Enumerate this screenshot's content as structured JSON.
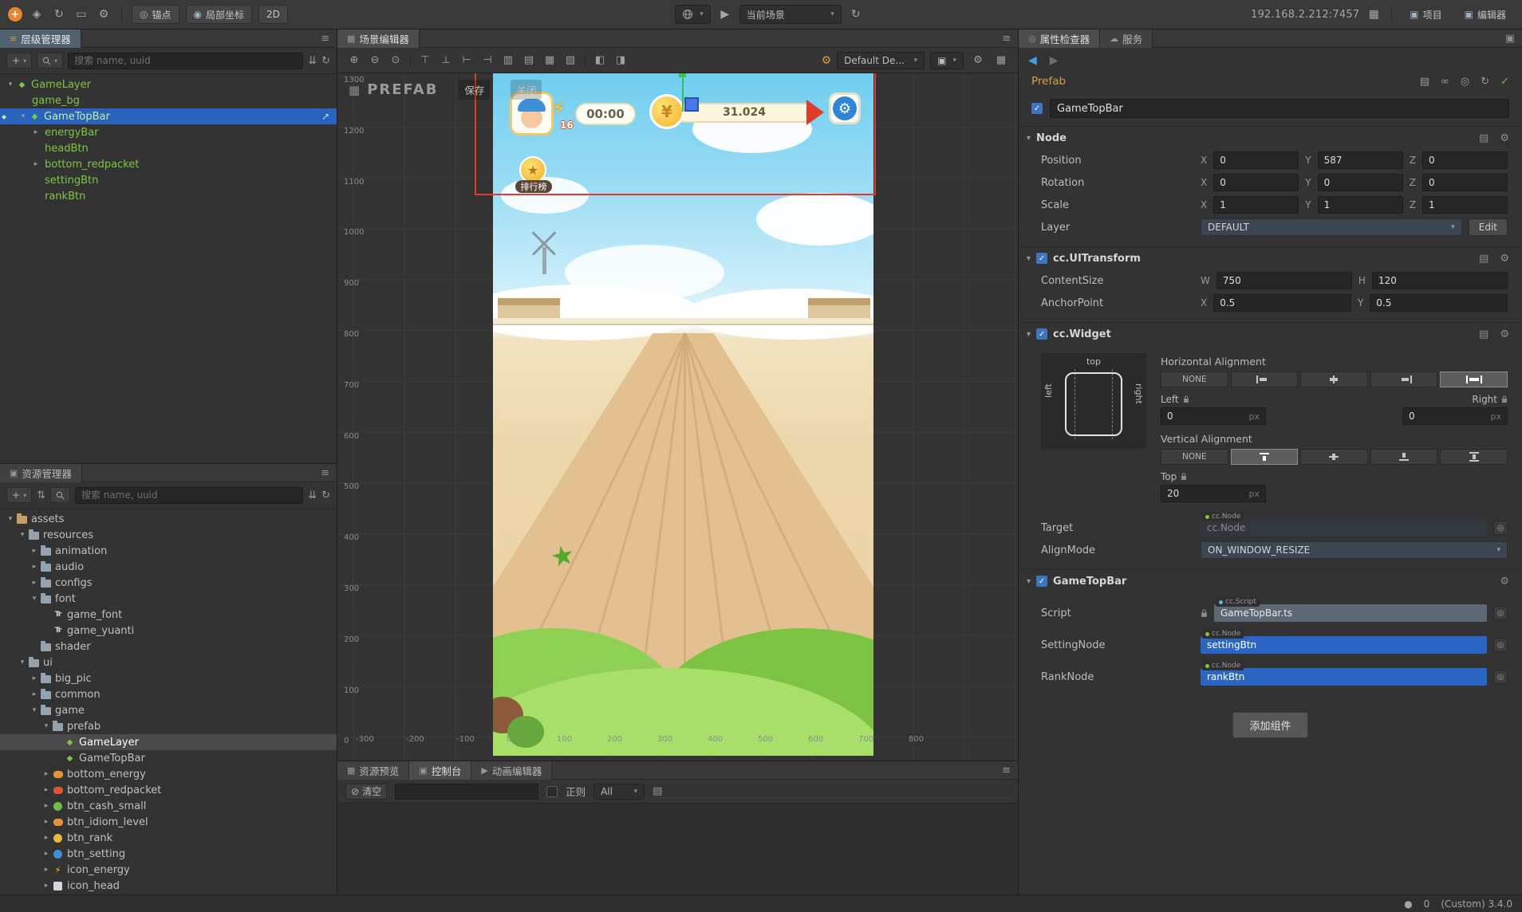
{
  "icons": {
    "hamburger": "≡",
    "list": "≡",
    "caret_down": "▾",
    "caret_right": "▸",
    "plus": "+",
    "refresh": "↻",
    "gear": "⚙",
    "play": "▶",
    "back": "◀",
    "forward": "▶",
    "sort": "⇅",
    "collapse_all": "⇊",
    "bolt": "⚡",
    "star": "★",
    "yen": "¥",
    "check": "✓",
    "open_external": "↗",
    "clear": "⊘",
    "doc": "▤",
    "grid": "▦",
    "panel": "▣",
    "target": "◎",
    "anchor_mode": "◎",
    "local_coords": "◉",
    "link": "∞",
    "move_tool": "◈",
    "rotate_tool": "↻",
    "scale_tool": "◱",
    "rect_tool": "▭",
    "cloud": "☁",
    "inspector": "◎",
    "dot": "●",
    "prefab": "◆"
  },
  "topbar": {
    "anchor": "锚点",
    "coords": "局部坐标",
    "mode2d": "2D",
    "scene_select": "当前场景",
    "ip": "192.168.2.212:7457",
    "project": "项目",
    "editor": "编辑器"
  },
  "hierarchy": {
    "title": "层级管理器",
    "search_placeholder": "搜索 name, uuid",
    "items": [
      {
        "label": "GameLayer",
        "level": 0,
        "arrow": "down",
        "icon": "prefab"
      },
      {
        "label": "game_bg",
        "level": 1,
        "arrow": "none",
        "icon": "none"
      },
      {
        "label": "GameTopBar",
        "level": 1,
        "arrow": "down",
        "icon": "prefab",
        "selected": true,
        "trailing": true
      },
      {
        "label": "energyBar",
        "level": 2,
        "arrow": "right",
        "icon": "none"
      },
      {
        "label": "headBtn",
        "level": 2,
        "arrow": "none",
        "icon": "none"
      },
      {
        "label": "bottom_redpacket",
        "level": 2,
        "arrow": "right",
        "icon": "none"
      },
      {
        "label": "settingBtn",
        "level": 2,
        "arrow": "none",
        "icon": "none"
      },
      {
        "label": "rankBtn",
        "level": 2,
        "arrow": "none",
        "icon": "none"
      }
    ]
  },
  "assets": {
    "title": "资源管理器",
    "search_placeholder": "搜索 name, uuid",
    "items": [
      {
        "label": "assets",
        "level": 0,
        "arrow": "down",
        "icon": "folder-root"
      },
      {
        "label": "resources",
        "level": 1,
        "arrow": "down",
        "icon": "folder"
      },
      {
        "label": "animation",
        "level": 2,
        "arrow": "right",
        "icon": "folder"
      },
      {
        "label": "audio",
        "level": 2,
        "arrow": "right",
        "icon": "folder"
      },
      {
        "label": "configs",
        "level": 2,
        "arrow": "right",
        "icon": "folder"
      },
      {
        "label": "font",
        "level": 2,
        "arrow": "down",
        "icon": "folder"
      },
      {
        "label": "game_font",
        "level": 3,
        "arrow": "none",
        "icon": "font-file"
      },
      {
        "label": "game_yuanti",
        "level": 3,
        "arrow": "none",
        "icon": "font-file"
      },
      {
        "label": "shader",
        "level": 2,
        "arrow": "none",
        "icon": "folder"
      },
      {
        "label": "ui",
        "level": 1,
        "arrow": "down",
        "icon": "folder"
      },
      {
        "label": "big_pic",
        "level": 2,
        "arrow": "right",
        "icon": "folder"
      },
      {
        "label": "common",
        "level": 2,
        "arrow": "right",
        "icon": "folder"
      },
      {
        "label": "game",
        "level": 2,
        "arrow": "down",
        "icon": "folder"
      },
      {
        "label": "prefab",
        "level": 3,
        "arrow": "down",
        "icon": "folder"
      },
      {
        "label": "GameLayer",
        "level": 4,
        "arrow": "none",
        "icon": "prefab",
        "selected": true
      },
      {
        "label": "GameTopBar",
        "level": 4,
        "arrow": "none",
        "icon": "prefab"
      },
      {
        "label": "bottom_energy",
        "level": 3,
        "arrow": "right",
        "icon": "sprite-orange"
      },
      {
        "label": "bottom_redpacket",
        "level": 3,
        "arrow": "right",
        "icon": "sprite-red"
      },
      {
        "label": "btn_cash_small",
        "level": 3,
        "arrow": "right",
        "icon": "sprite-green"
      },
      {
        "label": "btn_idiom_level",
        "level": 3,
        "arrow": "right",
        "icon": "sprite-orange"
      },
      {
        "label": "btn_rank",
        "level": 3,
        "arrow": "right",
        "icon": "sprite-gold"
      },
      {
        "label": "btn_setting",
        "level": 3,
        "arrow": "right",
        "icon": "sprite-blue"
      },
      {
        "label": "icon_energy",
        "level": 3,
        "arrow": "right",
        "icon": "sprite-bolt"
      },
      {
        "label": "icon_head",
        "level": 3,
        "arrow": "right",
        "icon": "sprite-image"
      }
    ]
  },
  "scene": {
    "tab": "场景编辑器",
    "prefab_label": "PREFAB",
    "save": "保存",
    "close": "关闭",
    "camera_select": "Default De...",
    "toolbar_icons": [
      {
        "name": "zoom-in-icon",
        "glyph": "⊕"
      },
      {
        "name": "zoom-out-icon",
        "glyph": "⊖"
      },
      {
        "name": "zoom-reset-icon",
        "glyph": "⊙"
      },
      {
        "name": "sep"
      },
      {
        "name": "align-top-icon",
        "glyph": "⊤"
      },
      {
        "name": "align-bottom-icon",
        "glyph": "⊥"
      },
      {
        "name": "align-left-icon",
        "glyph": "⊢"
      },
      {
        "name": "align-right-icon",
        "glyph": "⊣"
      },
      {
        "name": "align-center-h-icon",
        "glyph": "▥"
      },
      {
        "name": "align-center-v-icon",
        "glyph": "▤"
      },
      {
        "name": "distribute-h-icon",
        "glyph": "▦"
      },
      {
        "name": "distribute-v-icon",
        "glyph": "▧"
      },
      {
        "name": "sep"
      },
      {
        "name": "stretch-h-icon",
        "glyph": "◧"
      },
      {
        "name": "stretch-v-icon",
        "glyph": "◨"
      }
    ],
    "vruler": [
      "1300",
      "1200",
      "1100",
      "1000",
      "900",
      "800",
      "700",
      "600",
      "500",
      "400",
      "300",
      "200",
      "100",
      "0"
    ],
    "hruler": [
      "-300",
      "-200",
      "-100",
      "0",
      "100",
      "200",
      "300",
      "400",
      "500",
      "600",
      "700",
      "800"
    ],
    "game": {
      "timer": "00:00",
      "energy": "16",
      "coins": "31.024",
      "rank": "排行榜"
    }
  },
  "console": {
    "tabs": [
      {
        "label": "资源预览",
        "name": "asset-preview",
        "icon": "▦"
      },
      {
        "label": "控制台",
        "name": "console",
        "icon": "▣",
        "active": true
      },
      {
        "label": "动画编辑器",
        "name": "animation-editor",
        "icon": "▶"
      }
    ],
    "clear": "清空",
    "regex": "正则",
    "filter": "All"
  },
  "inspector": {
    "tab_inspector": "属性检查器",
    "tab_service": "服务",
    "prefab_badge": "Prefab",
    "node_name": "GameTopBar",
    "axes": {
      "x": "X",
      "y": "Y",
      "z": "Z"
    },
    "node": {
      "title": "Node",
      "position_label": "Position",
      "position": {
        "x": "0",
        "y": "587",
        "z": "0"
      },
      "rotation_label": "Rotation",
      "rotation": {
        "x": "0",
        "y": "0",
        "z": "0"
      },
      "scale_label": "Scale",
      "scale": {
        "x": "1",
        "y": "1",
        "z": "1"
      },
      "layer_label": "Layer",
      "layer_value": "DEFAULT",
      "edit": "Edit"
    },
    "uitransform": {
      "title": "cc.UITransform",
      "contentsize_label": "ContentSize",
      "w_label": "W",
      "w": "750",
      "h_label": "H",
      "h": "120",
      "anchorpoint_label": "AnchorPoint",
      "ax": "0.5",
      "ay": "0.5"
    },
    "widget": {
      "title": "cc.Widget",
      "h_align_label": "Horizontal Alignment",
      "v_align_label": "Vertical Alignment",
      "none": "NONE",
      "left_label": "Left",
      "right_label": "Right",
      "top_label": "Top",
      "left_value": "0",
      "right_value": "0",
      "top_value": "20",
      "px": "px",
      "diagram": {
        "top": "top",
        "left": "left",
        "right": "right"
      },
      "target_label": "Target",
      "target_type": "cc.Node",
      "target_value": "cc.Node",
      "alignmode_label": "AlignMode",
      "alignmode_value": "ON_WINDOW_RESIZE"
    },
    "component": {
      "title": "GameTopBar",
      "script_label": "Script",
      "script_type": "cc.Script",
      "script_value": "GameTopBar.ts",
      "setting_label": "SettingNode",
      "setting_type": "cc.Node",
      "setting_value": "settingBtn",
      "rank_label": "RankNode",
      "rank_type": "cc.Node",
      "rank_value": "rankBtn"
    },
    "add_component": "添加组件"
  },
  "statusbar": {
    "count": "0",
    "version": "(Custom) 3.4.0"
  }
}
